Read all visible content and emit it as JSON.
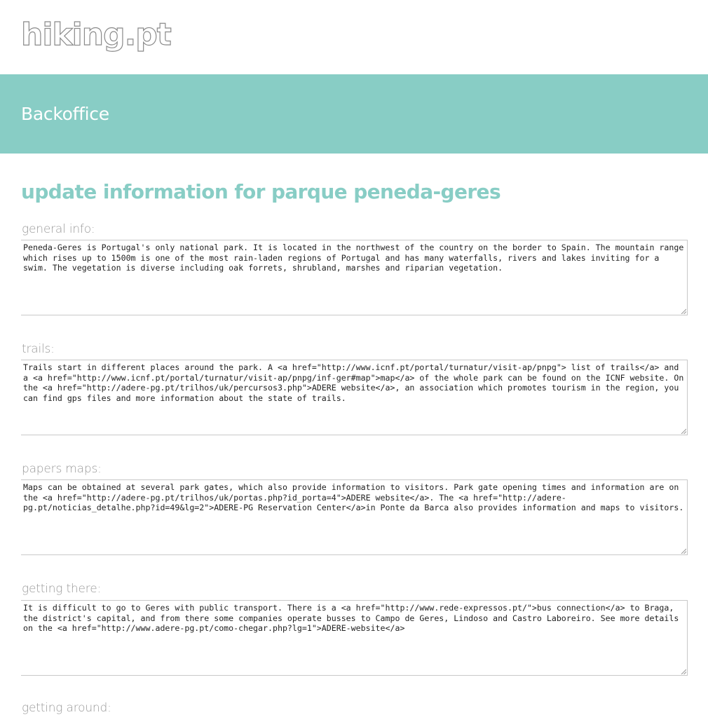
{
  "header": {
    "logo_text": "hiking.pt"
  },
  "banner": {
    "title": "Backoffice"
  },
  "main": {
    "title": "update information for parque peneda-geres",
    "fields": [
      {
        "label": "general info:",
        "value": "Peneda-Geres is Portugal's only national park. It is located in the northwest of the country on the border to Spain. The mountain range which rises up to 1500m is one of the most rain-laden regions of Portugal and has many waterfalls, rivers and lakes inviting for a swim. The vegetation is diverse including oak forrets, shrubland, marshes and riparian vegetation."
      },
      {
        "label": "trails:",
        "value": "Trails start in different places around the park. A <a href=\"http://www.icnf.pt/portal/turnatur/visit-ap/pnpg\"> list of trails</a> and a <a href=\"http://www.icnf.pt/portal/turnatur/visit-ap/pnpg/inf-ger#map\">map</a> of the whole park can be found on the ICNF website. On the <a href=\"http://adere-pg.pt/trilhos/uk/percursos3.php\">ADERE website</a>, an association which promotes tourism in the region, you can find gps files and more information about the state of trails."
      },
      {
        "label": "papers maps:",
        "value": "Maps can be obtained at several park gates, which also provide information to visitors. Park gate opening times and information are on the <a href=\"http://adere-pg.pt/trilhos/uk/portas.php?id_porta=4\">ADERE website</a>. The <a href=\"http://adere-pg.pt/noticias_detalhe.php?id=49&lg=2\">ADERE-PG Reservation Center</a>in Ponte da Barca also provides information and maps to visitors."
      },
      {
        "label": "getting there:",
        "value": "It is difficult to go to Geres with public transport. There is a <a href=\"http://www.rede-expressos.pt/\">bus connection</a> to Braga, the district's capital, and from there some companies operate busses to Campo de Geres, Lindoso and Castro Laboreiro. See more details on the <a href=\"http://www.adere-pg.pt/como-chegar.php?lg=1\">ADERE-website</a>"
      },
      {
        "label": "getting around:",
        "value": ""
      }
    ]
  },
  "colors": {
    "accent": "#88cdc5",
    "label": "#9a9a9a",
    "border": "#c8c8c8"
  }
}
